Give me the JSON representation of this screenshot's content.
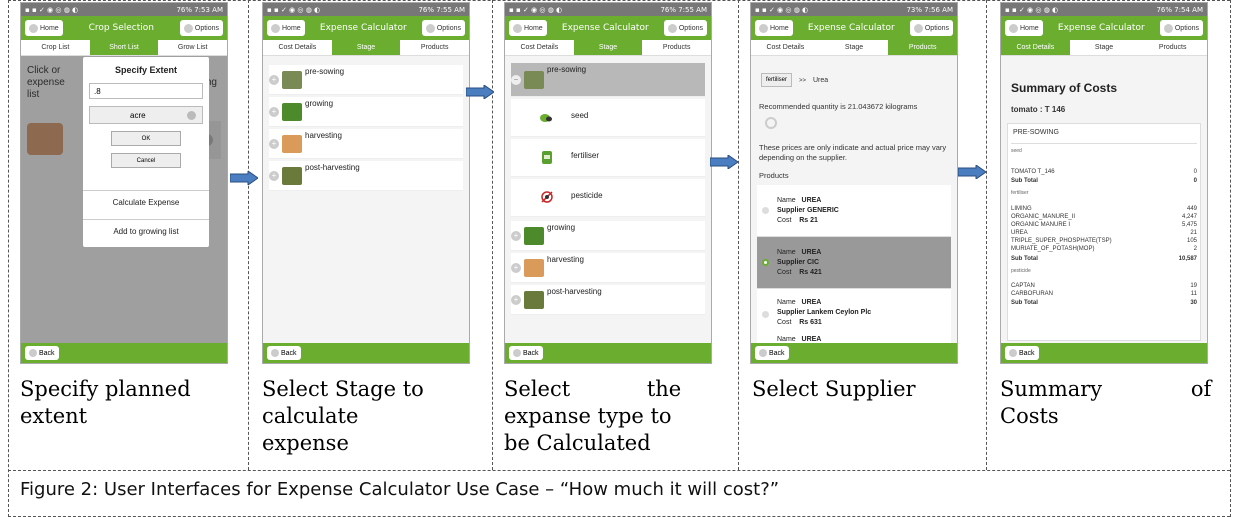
{
  "statusbar": {
    "p1": "76% 7:53 AM",
    "p2": "76% 7:55 AM",
    "p3": "76% 7:55 AM",
    "p4": "73% 7:56 AM",
    "p5": "76% 7:54 AM"
  },
  "common": {
    "home": "Home",
    "options": "Options",
    "back": "Back"
  },
  "screen1": {
    "title": "Crop Selection",
    "tabs": [
      "Crop List",
      "Short List",
      "Grow List"
    ],
    "under_text_1": "Click or",
    "under_text_2": "expense",
    "under_text_3": "list",
    "under_text_right": "owing",
    "dialog_title": "Specify Extent",
    "extent_value": ".8",
    "unit": "acre",
    "ok": "OK",
    "cancel": "Cancel",
    "menu_calc": "Calculate Expense",
    "menu_add": "Add to growing list"
  },
  "screen2": {
    "title": "Expense Calculator",
    "tabs": [
      "Cost Details",
      "Stage",
      "Products"
    ],
    "stages": [
      "pre-sowing",
      "growing",
      "harvesting",
      "post-harvesting"
    ]
  },
  "screen3": {
    "title": "Expense Calculator",
    "tabs": [
      "Cost Details",
      "Stage",
      "Products"
    ],
    "stage_open": "pre-sowing",
    "types": [
      "seed",
      "fertiliser",
      "pesticide"
    ],
    "stages_rest": [
      "growing",
      "harvesting",
      "post-harvesting"
    ]
  },
  "screen4": {
    "title": "Expense Calculator",
    "tabs": [
      "Cost Details",
      "Stage",
      "Products"
    ],
    "filter_type": "fertiliser",
    "filter_sep": ">>",
    "filter_product": "Urea",
    "recommended": "Recommended quantity is 21.043672 kilograms",
    "disclaimer": "These prices are only indicate and actual price may vary depending on the supplier.",
    "products_label": "Products",
    "suppliers": [
      {
        "name": "UREA",
        "supplier": "GENERIC",
        "cost": "Rs 21"
      },
      {
        "name": "UREA",
        "supplier": "CIC",
        "cost": "Rs 421"
      },
      {
        "name": "UREA",
        "supplier": "Lankem Ceylon Plc",
        "cost": "Rs 631"
      },
      {
        "name": "UREA",
        "supplier": "",
        "cost": ""
      }
    ],
    "labels": {
      "name": "Name",
      "supplier": "Supplier",
      "cost": "Cost"
    }
  },
  "screen5": {
    "title": "Expense Calculator",
    "tabs": [
      "Cost Details",
      "Stage",
      "Products"
    ],
    "heading": "Summary of Costs",
    "crop": "tomato : T 146",
    "stage": "PRE-SOWING",
    "seed_label": "seed",
    "seed_items": [
      {
        "name": "TOMATO T_146",
        "value": "0"
      }
    ],
    "seed_subtotal": "0",
    "fert_label": "fertiliser",
    "fert_items": [
      {
        "name": "LIMING",
        "value": "449"
      },
      {
        "name": "ORGANIC_MANURE_II",
        "value": "4,247"
      },
      {
        "name": "ORGANIC MANURE I",
        "value": "5,475"
      },
      {
        "name": "UREA",
        "value": "21"
      },
      {
        "name": "TRIPLE_SUPER_PHOSPHATE(TSP)",
        "value": "105"
      },
      {
        "name": "MURIATE_OF_POTASH(MOP)",
        "value": "2"
      }
    ],
    "fert_subtotal": "10,587",
    "pest_label": "pesticide",
    "pest_items": [
      {
        "name": "CAPTAN",
        "value": "19"
      },
      {
        "name": "CARBOFURAN",
        "value": "11"
      }
    ],
    "pest_subtotal": "30",
    "subtotal_label": "Sub Total"
  },
  "captions": {
    "c1a": "Specify planned",
    "c1b": "extent",
    "c2a": "Select Stage to",
    "c2b": "calculate",
    "c2c": "expense",
    "c3a": "Select the",
    "c3b": "expanse type to",
    "c3c": "be Calculated",
    "c4": "Select Supplier",
    "c5a": "Summary of",
    "c5b": "Costs"
  },
  "figure_caption": "Figure 2: User Interfaces for Expense Calculator Use Case – “How much it will cost?”"
}
